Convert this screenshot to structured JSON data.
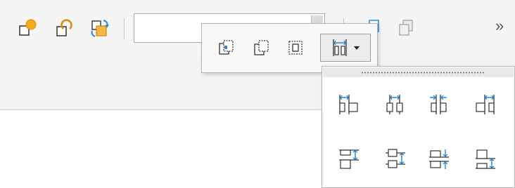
{
  "toolbar": {
    "buttons": [
      "insert-shape-icon",
      "insert-shape-alt-icon",
      "change-shape-icon"
    ],
    "combo_value": "",
    "more_label": "»"
  },
  "popup": {
    "buttons": [
      "align-center-icon",
      "align-bring-icon",
      "align-send-icon",
      "distribute-icon"
    ],
    "active": "distribute-icon"
  },
  "panel": {
    "rows": [
      [
        "distribute-horizontal-left-icon",
        "distribute-horizontal-center-icon",
        "distribute-horizontal-inward-icon",
        "distribute-horizontal-right-icon"
      ],
      [
        "distribute-vertical-top-icon",
        "distribute-vertical-middle-icon",
        "distribute-vertical-inward-icon",
        "distribute-vertical-bottom-icon"
      ]
    ]
  },
  "colors": {
    "accent_blue": "#2b89d8",
    "accent_orange": "#f5a623",
    "icon_stroke": "#333333"
  }
}
